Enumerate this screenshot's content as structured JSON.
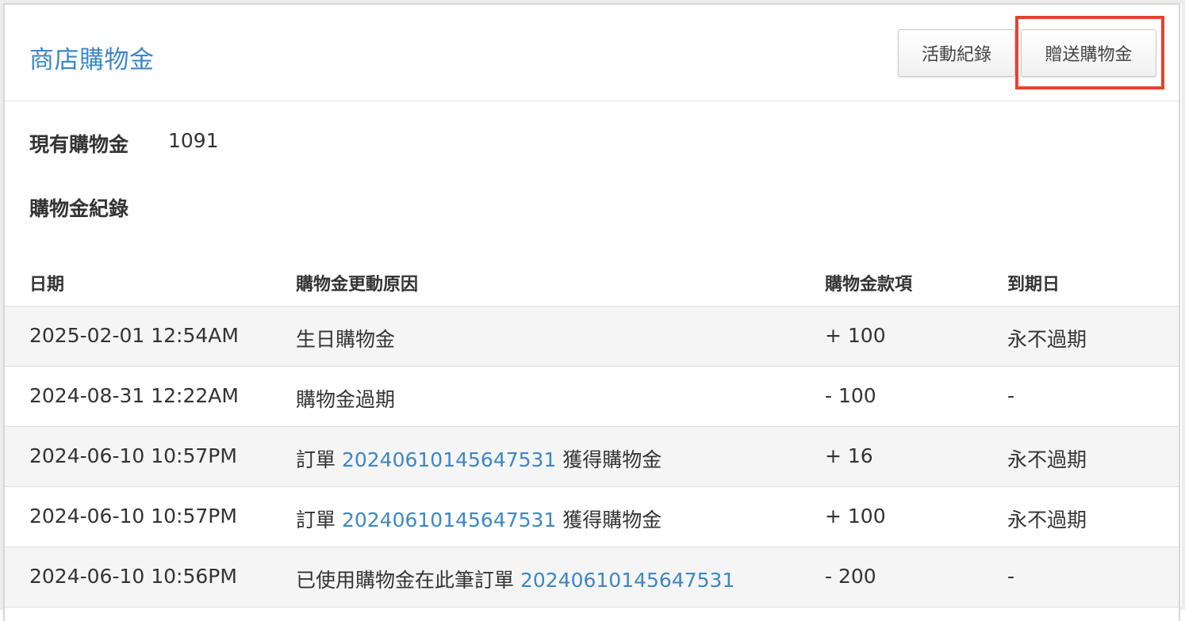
{
  "header": {
    "title": "商店購物金",
    "activity_button": "活動紀錄",
    "gift_button": "贈送購物金"
  },
  "balance": {
    "label": "現有購物金",
    "value": "1091"
  },
  "records": {
    "title": "購物金紀錄",
    "columns": {
      "date": "日期",
      "reason": "購物金更動原因",
      "amount": "購物金款項",
      "expiry": "到期日"
    },
    "rows": [
      {
        "date": "2025-02-01 12:54AM",
        "reason_prefix": "生日購物金",
        "order_link": "",
        "reason_suffix": "",
        "amount": "+ 100",
        "expiry": "永不過期"
      },
      {
        "date": "2024-08-31 12:22AM",
        "reason_prefix": "購物金過期",
        "order_link": "",
        "reason_suffix": "",
        "amount": "- 100",
        "expiry": "-"
      },
      {
        "date": "2024-06-10 10:57PM",
        "reason_prefix": "訂單 ",
        "order_link": "20240610145647531",
        "reason_suffix": " 獲得購物金",
        "amount": "+ 16",
        "expiry": "永不過期"
      },
      {
        "date": "2024-06-10 10:57PM",
        "reason_prefix": "訂單 ",
        "order_link": "20240610145647531",
        "reason_suffix": " 獲得購物金",
        "amount": "+ 100",
        "expiry": "永不過期"
      },
      {
        "date": "2024-06-10 10:56PM",
        "reason_prefix": "已使用購物金在此筆訂單 ",
        "order_link": "20240610145647531",
        "reason_suffix": "",
        "amount": "- 200",
        "expiry": "-"
      }
    ]
  },
  "colors": {
    "accent_link": "#3d87c6",
    "highlight": "#e7432c"
  }
}
